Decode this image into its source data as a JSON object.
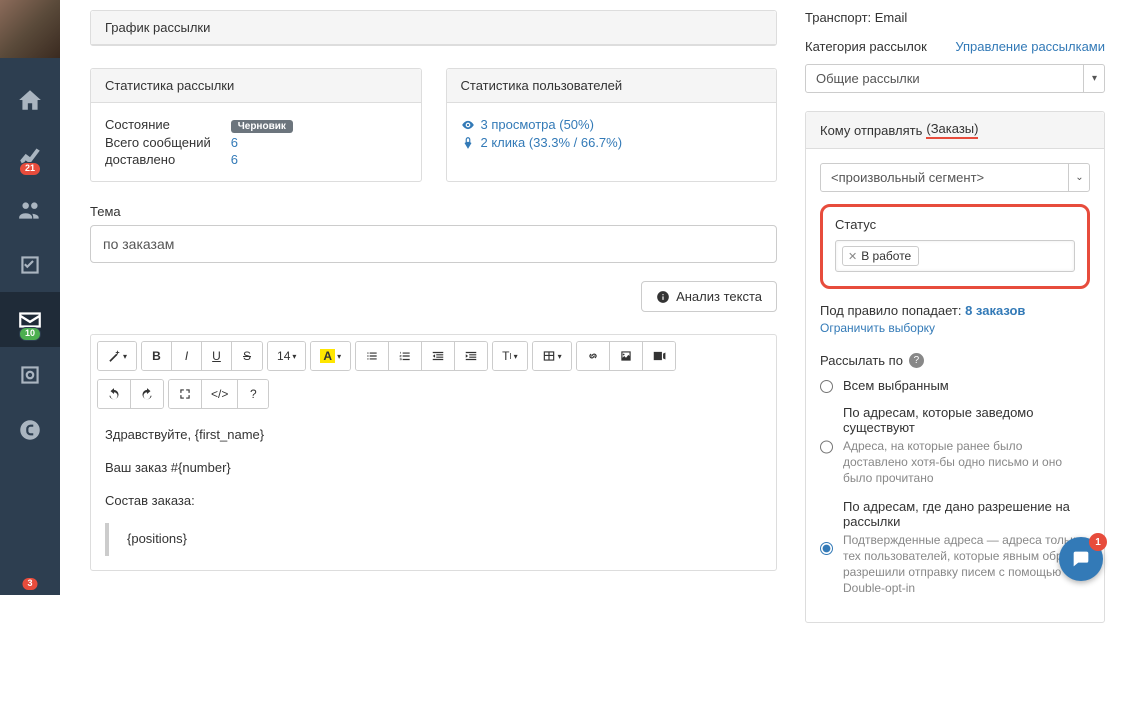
{
  "sidebar": {
    "badges": {
      "avatar": "3",
      "stats": "21",
      "mail": "10"
    }
  },
  "panels": {
    "schedule": {
      "title": "График рассылки"
    },
    "stats": {
      "title": "Статистика рассылки",
      "state_label": "Состояние",
      "state_value": "Черновик",
      "total_label": "Всего сообщений",
      "total_value": "6",
      "delivered_label": "доставлено",
      "delivered_value": "6"
    },
    "user_stats": {
      "title": "Статистика пользователей",
      "views": "3 просмотра (50%)",
      "clicks": "2 клика (33.3% / 66.7%)"
    }
  },
  "theme": {
    "label": "Тема",
    "value": "по заказам"
  },
  "analyze_btn": "Анализ текста",
  "editor": {
    "h_size": "14",
    "line1": "Здравствуйте, {first_name}",
    "line2": "Ваш заказ #{number}",
    "line3": "Состав заказа:",
    "quote": "{positions}"
  },
  "right": {
    "transport_label": "Транспорт:",
    "transport_value": "Email",
    "category_label": "Категория рассылок",
    "manage_link": "Управление рассылками",
    "category_value": "Общие рассылки",
    "recipients_title": "Кому отправлять",
    "recipients_annot": "(Заказы)",
    "segment_value": "<произвольный сегмент>",
    "status_label": "Статус",
    "status_chip": "В работе",
    "rule_text": "Под правило попадает:",
    "rule_count": "8 заказов",
    "limit_link": "Ограничить выборку",
    "send_by_title": "Рассылать по",
    "radio": {
      "r1": "Всем выбранным",
      "r2": "По адресам, которые заведомо существуют",
      "r2_sub": "Адреса, на которые ранее было доставлено хотя-бы одно письмо и оно было прочитано",
      "r3": "По адресам, где дано разрешение на рассылки",
      "r3_sub": "Подтвержденные адреса — адреса только тех пользователей, которые явным образом разрешили отправку писем с помощью Double-opt-in"
    }
  },
  "fab_badge": "1"
}
